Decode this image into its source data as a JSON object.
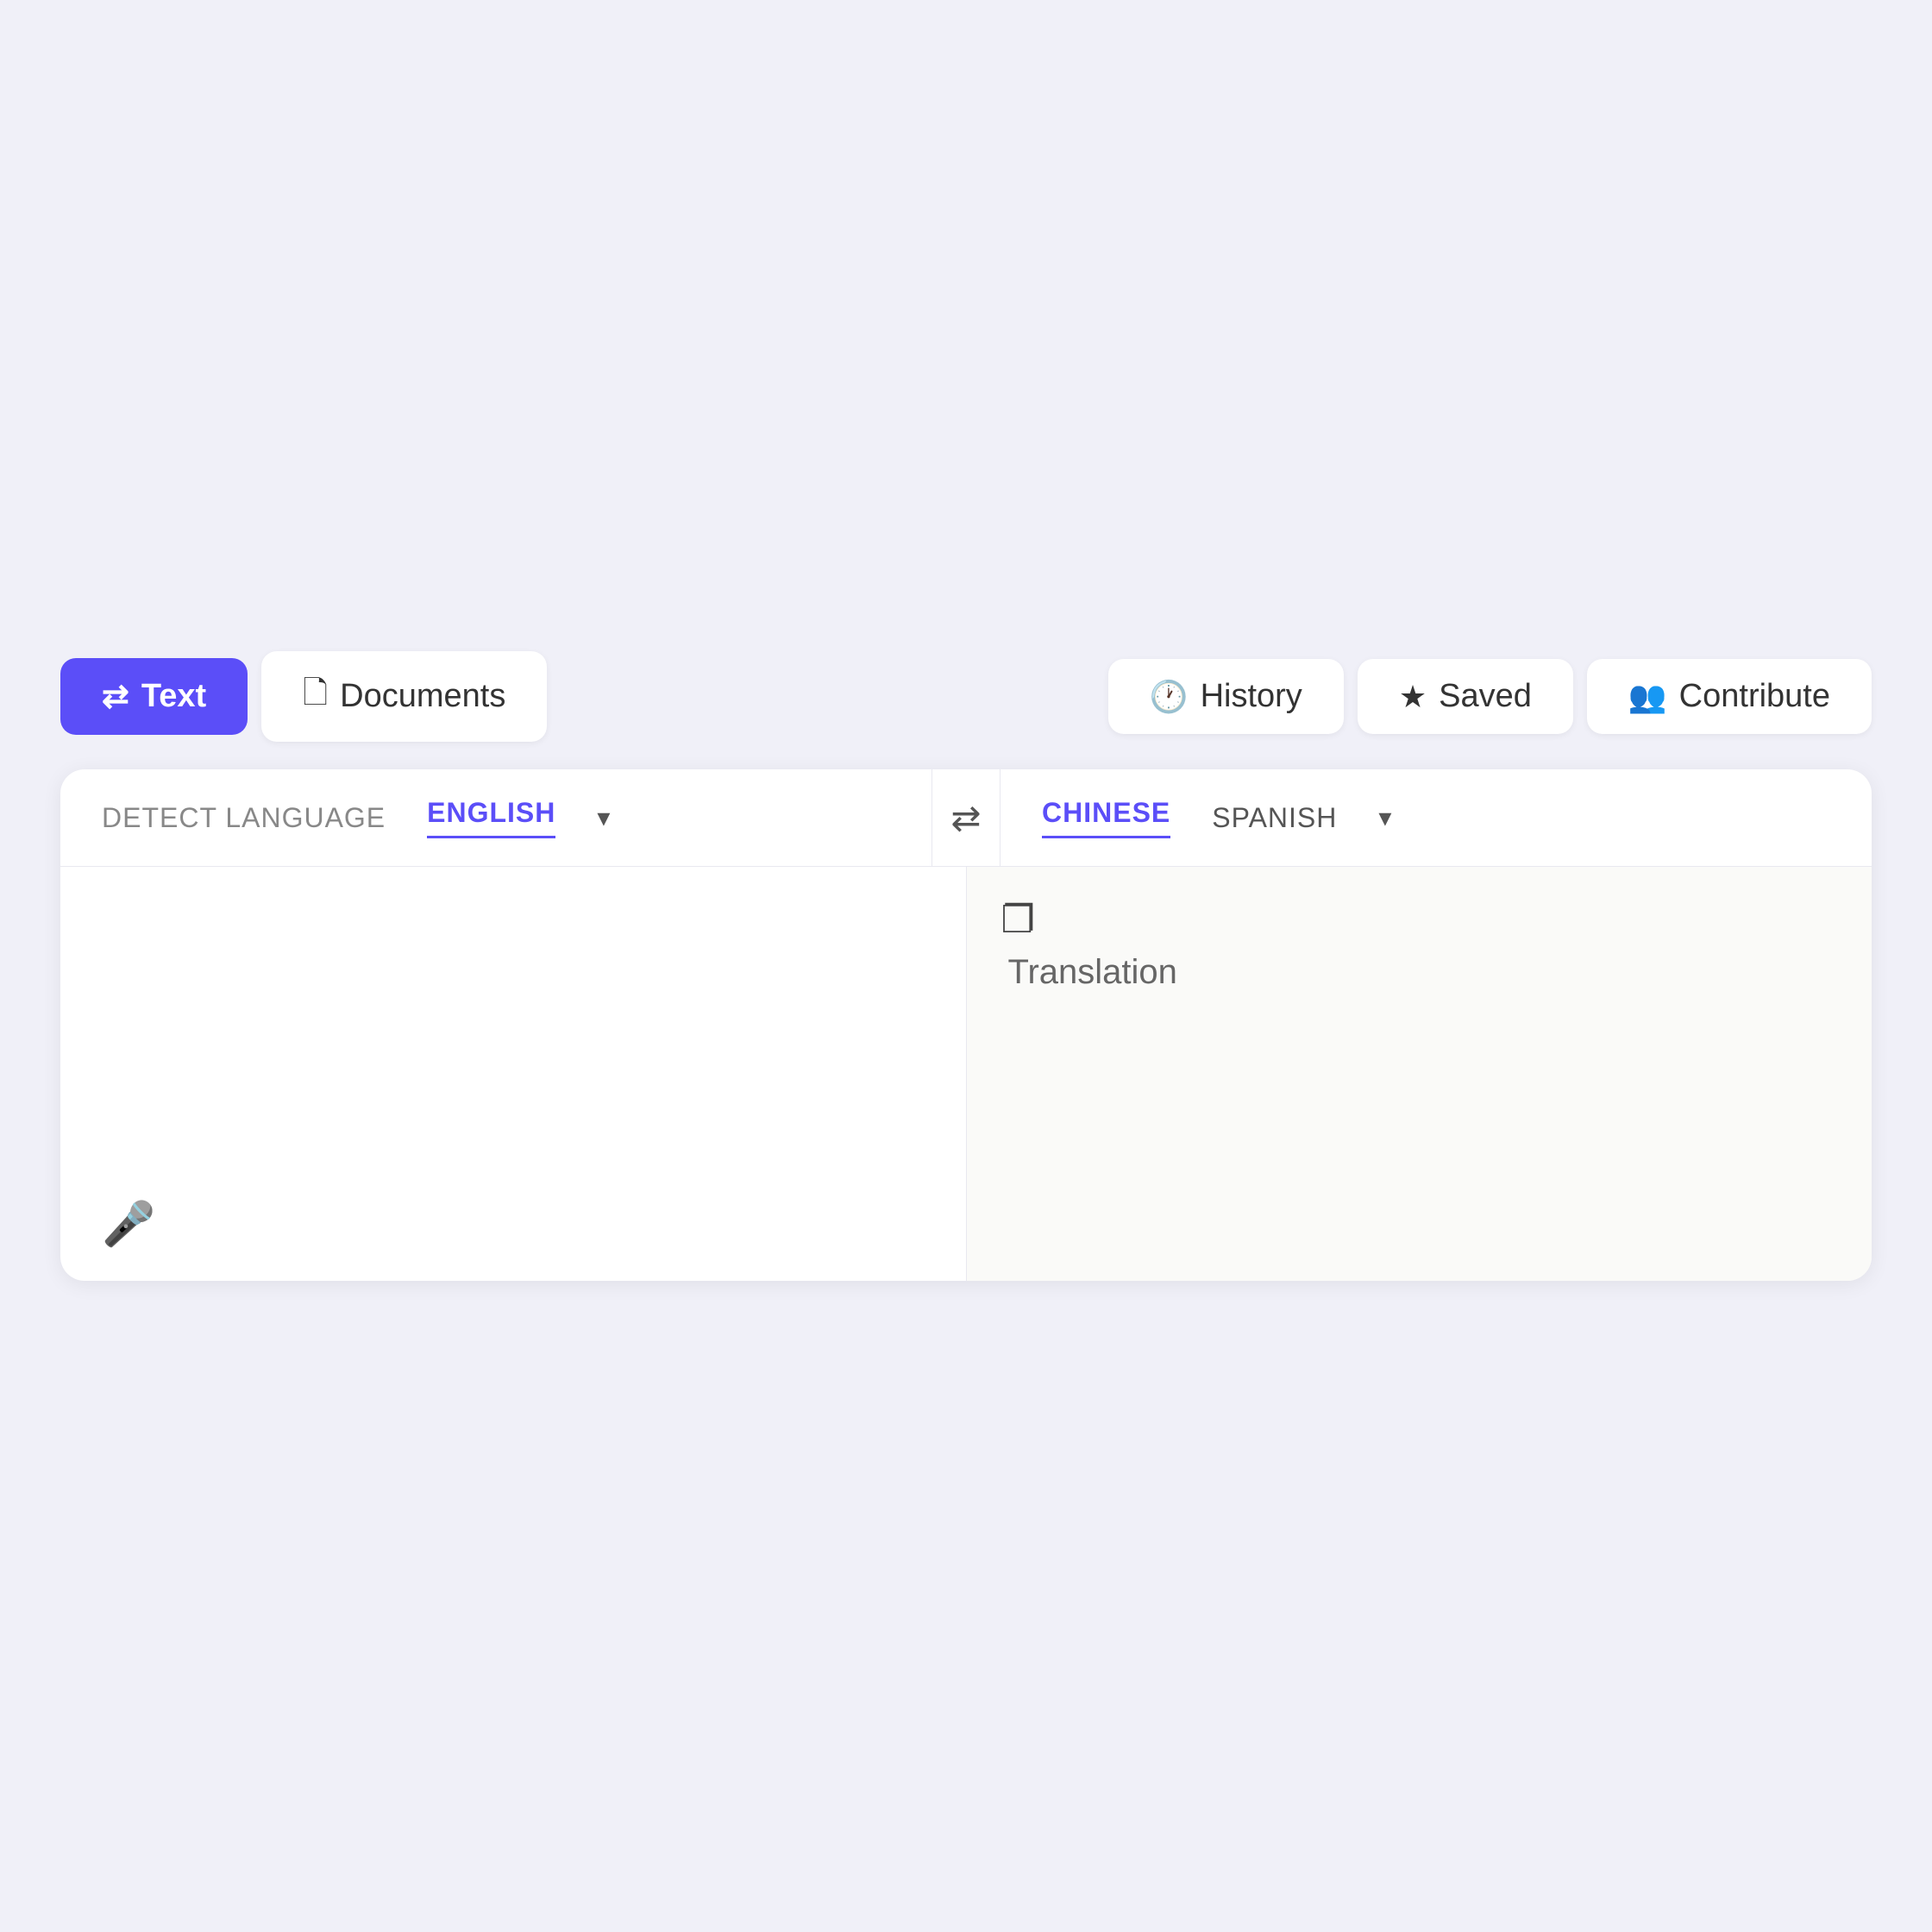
{
  "toolbar": {
    "text_label": "Text",
    "documents_label": "Documents",
    "history_label": "History",
    "saved_label": "Saved",
    "contribute_label": "Contribute"
  },
  "source_panel": {
    "detect_language": "DETECT LANGUAGE",
    "active_language": "ENGLISH"
  },
  "target_panel": {
    "active_language": "CHINESE",
    "second_language": "SPANISH"
  },
  "translation": {
    "placeholder": "Translation"
  },
  "icons": {
    "text_icon": "⇄",
    "document_icon": "📄",
    "history_icon": "⏱",
    "saved_icon": "★",
    "contribute_icon": "👥",
    "mic_icon": "🎤",
    "copy_icon": "❐",
    "swap_icon": "⇄",
    "chevron": "▾"
  }
}
